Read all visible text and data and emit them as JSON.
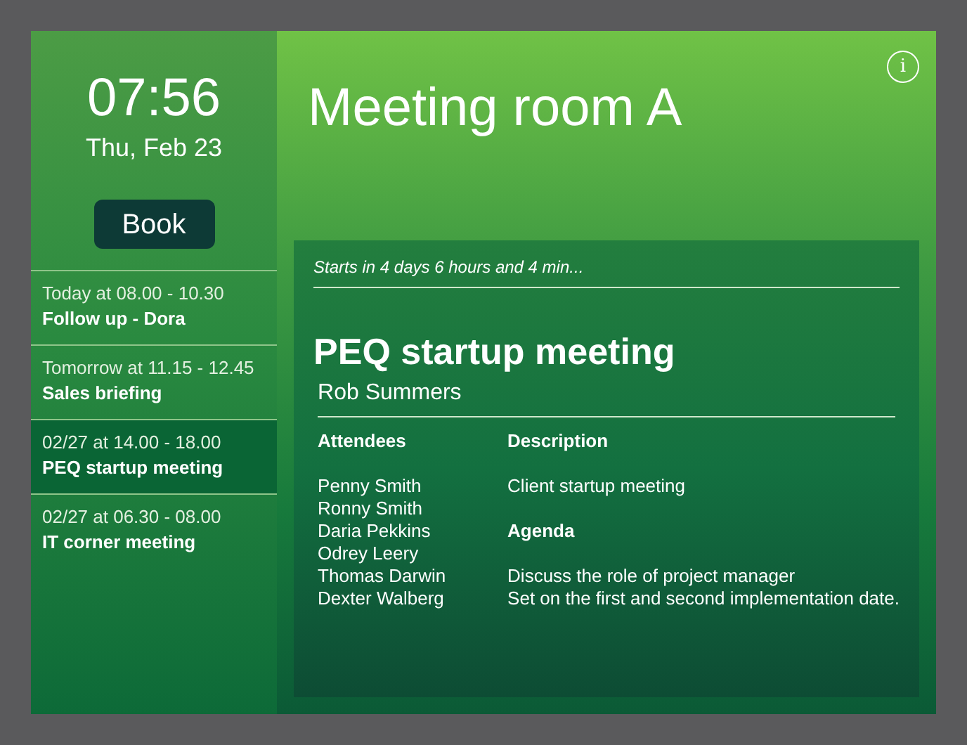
{
  "clock": {
    "time": "07:56",
    "date": "Thu, Feb 23"
  },
  "book_button": "Book",
  "bookings": [
    {
      "when": "Today at 08.00 - 10.30",
      "title": "Follow up - Dora",
      "selected": false
    },
    {
      "when": "Tomorrow at 11.15 - 12.45",
      "title": "Sales briefing",
      "selected": false
    },
    {
      "when": "02/27 at 14.00 - 18.00",
      "title": "PEQ startup meeting",
      "selected": true
    },
    {
      "when": "02/27 at 06.30 - 08.00",
      "title": "IT corner meeting",
      "selected": false
    }
  ],
  "room": {
    "title": "Meeting room A",
    "info_button": "i"
  },
  "meeting": {
    "countdown": "Starts in 4 days 6 hours and 4 min...",
    "title": "PEQ startup meeting",
    "organizer": "Rob Summers",
    "attendees_heading": "Attendees",
    "attendees": [
      "Penny Smith",
      "Ronny Smith",
      "Daria Pekkins",
      "Odrey Leery",
      "Thomas Darwin",
      "Dexter Walberg"
    ],
    "description_heading": "Description",
    "description": "Client startup meeting",
    "agenda_heading": "Agenda",
    "agenda": [
      "Discuss the role of project manager",
      "Set on the first and second implementation date."
    ]
  }
}
